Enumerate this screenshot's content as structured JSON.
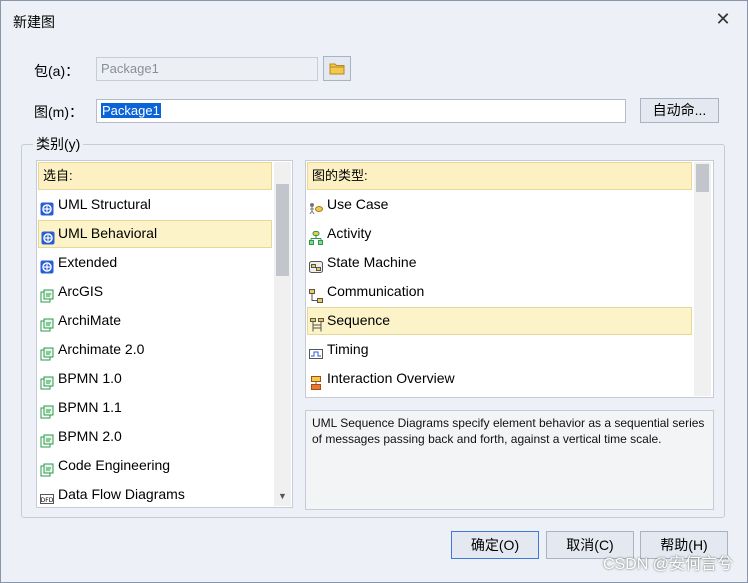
{
  "window": {
    "title": "新建图",
    "close_glyph": "✕"
  },
  "package": {
    "label": "包(a)：",
    "value": "Package1"
  },
  "diagram": {
    "label": "图(m)：",
    "value": "Package1",
    "auto_name_button": "自动命..."
  },
  "category": {
    "label": "类别(y)"
  },
  "select_from": {
    "header": "选自:",
    "items": [
      {
        "label": "UML Structural",
        "icon": "uml-icon"
      },
      {
        "label": "UML Behavioral",
        "icon": "uml-icon",
        "selected": true
      },
      {
        "label": "Extended",
        "icon": "uml-icon"
      },
      {
        "label": "ArcGIS",
        "icon": "technology-icon"
      },
      {
        "label": "ArchiMate",
        "icon": "technology-icon"
      },
      {
        "label": "Archimate 2.0",
        "icon": "technology-icon"
      },
      {
        "label": "BPMN 1.0",
        "icon": "technology-icon"
      },
      {
        "label": "BPMN 1.1",
        "icon": "technology-icon"
      },
      {
        "label": "BPMN 2.0",
        "icon": "technology-icon"
      },
      {
        "label": "Code Engineering",
        "icon": "technology-icon"
      },
      {
        "label": "Data Flow Diagrams",
        "icon": "dfd-icon"
      }
    ]
  },
  "diagram_types": {
    "header": "图的类型:",
    "items": [
      {
        "label": "Use Case",
        "icon": "use-case-icon"
      },
      {
        "label": "Activity",
        "icon": "activity-icon"
      },
      {
        "label": "State Machine",
        "icon": "state-machine-icon"
      },
      {
        "label": "Communication",
        "icon": "communication-icon"
      },
      {
        "label": "Sequence",
        "icon": "sequence-icon",
        "selected": true
      },
      {
        "label": "Timing",
        "icon": "timing-icon"
      },
      {
        "label": "Interaction Overview",
        "icon": "interaction-overview-icon"
      }
    ]
  },
  "description": "UML Sequence Diagrams specify element behavior as a sequential series of messages passing back and forth, against a vertical time scale.",
  "buttons": {
    "ok": "确定(O)",
    "cancel": "取消(C)",
    "help": "帮助(H)"
  },
  "watermark": "CSDN @安何言兮",
  "colors": {
    "selection_fill": "#fdf3c8",
    "text_selection": "#0a64d8"
  }
}
